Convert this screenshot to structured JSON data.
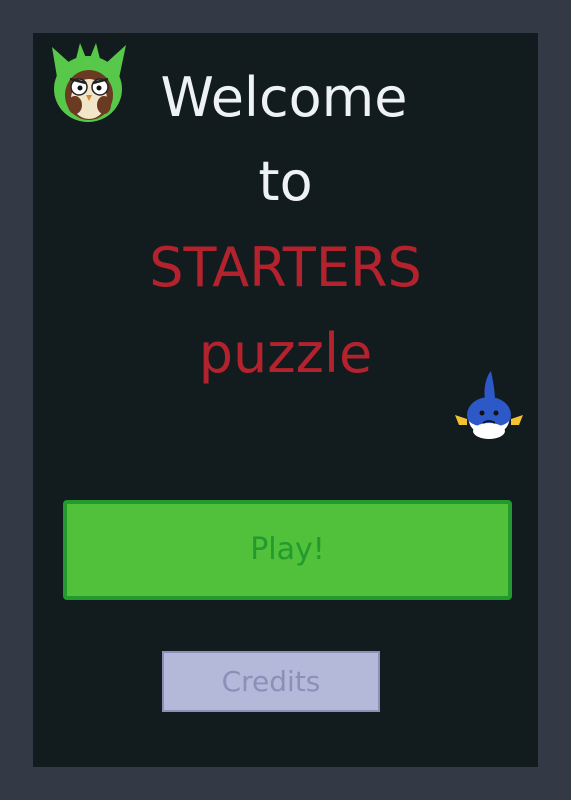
{
  "title": {
    "line1": "Welcome",
    "line2": "to",
    "line3": "STARTERS",
    "line4": "puzzle"
  },
  "buttons": {
    "play_label": "Play!",
    "credits_label": "Credits"
  },
  "colors": {
    "background": "#121c1e",
    "frame": "#333a46",
    "title_white": "#eef1f5",
    "title_red": "#b4222e",
    "play_fill": "#51c03a",
    "play_border": "#239a2d",
    "credits_fill": "#b4b9da",
    "credits_border": "#8a90b8"
  },
  "icons": {
    "left_mascot": "green-grass-starter-icon",
    "right_mascot": "blue-water-starter-icon"
  }
}
